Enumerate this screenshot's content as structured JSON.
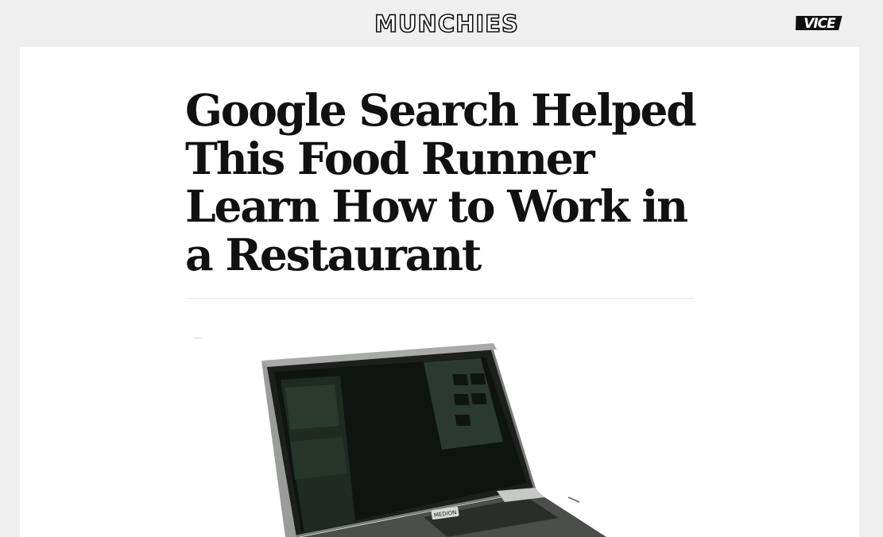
{
  "header": {
    "site_logo_text": "MUNCHIES",
    "network_logo_text": "VICE"
  },
  "article": {
    "title": "Google Search Helped This Food Runner Learn How to Work in a Restaurant",
    "hero_image_badge": "MEDION"
  },
  "colors": {
    "page_background": "#efefef",
    "card_background": "#ffffff",
    "text": "#111111",
    "divider": "#e6e6e6"
  },
  "icons": {
    "site_logo": "munchies-logo",
    "network_logo": "vice-logo",
    "hero_image": "laptop-photo"
  }
}
